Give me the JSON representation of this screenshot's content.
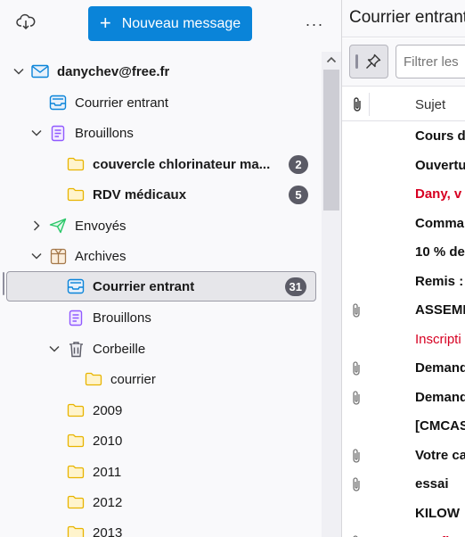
{
  "header": {
    "new_message_label": "Nouveau message",
    "menu_label": "···"
  },
  "folders": {
    "account": {
      "label": "danychev@free.fr"
    },
    "inbox": {
      "label": "Courrier entrant"
    },
    "drafts": {
      "label": "Brouillons"
    },
    "drafts_sub1": {
      "label": "couvercle chlorinateur ma...",
      "badge": "2"
    },
    "drafts_sub2": {
      "label": "RDV médicaux",
      "badge": "5"
    },
    "sent": {
      "label": "Envoyés"
    },
    "archives": {
      "label": "Archives"
    },
    "archives_inbox": {
      "label": "Courrier entrant",
      "badge": "31"
    },
    "archives_drafts": {
      "label": "Brouillons"
    },
    "trash": {
      "label": "Corbeille"
    },
    "trash_sub": {
      "label": "courrier"
    },
    "y2009": {
      "label": "2009"
    },
    "y2010": {
      "label": "2010"
    },
    "y2011": {
      "label": "2011"
    },
    "y2012": {
      "label": "2012"
    },
    "y2013": {
      "label": "2013"
    }
  },
  "message_pane": {
    "title": "Courrier entrant",
    "filter_placeholder": "Filtrer les",
    "columns": {
      "subject": "Sujet"
    },
    "messages": [
      {
        "subject": "Cours d",
        "attach": false,
        "style": "bold"
      },
      {
        "subject": "Ouvertu",
        "attach": false,
        "style": "bold"
      },
      {
        "subject": "Dany, v",
        "attach": false,
        "style": "red-bold"
      },
      {
        "subject": "Comma",
        "attach": false,
        "style": "bold"
      },
      {
        "subject": "10 % de",
        "attach": false,
        "style": "bold"
      },
      {
        "subject": "Remis :",
        "attach": false,
        "style": "bold"
      },
      {
        "subject": "ASSEMI",
        "attach": true,
        "style": "bold"
      },
      {
        "subject": "Inscripti",
        "attach": false,
        "style": "red-normal"
      },
      {
        "subject": "Demand",
        "attach": true,
        "style": "bold"
      },
      {
        "subject": "Demand",
        "attach": true,
        "style": "bold"
      },
      {
        "subject": "[CMCAS",
        "attach": false,
        "style": "bold"
      },
      {
        "subject": "Votre ca",
        "attach": true,
        "style": "bold"
      },
      {
        "subject": "essai",
        "attach": true,
        "style": "bold"
      },
      {
        "subject": "KILOW",
        "attach": false,
        "style": "bold"
      },
      {
        "subject": "Confirm",
        "attach": true,
        "style": "red-bold"
      }
    ]
  },
  "colors": {
    "accent": "#0a84d9",
    "unread_red": "#d70022",
    "badge": "#5b5b66",
    "folder_yellow": "#f5c542",
    "sent_green": "#2ac769",
    "drafts_purple": "#9059ff",
    "inbox_blue": "#0a84d9"
  },
  "icons": {
    "get_messages": "cloud-download-icon",
    "account": "envelope-icon",
    "inbox": "inbox-icon",
    "drafts": "draft-icon",
    "folder": "folder-icon",
    "sent": "paper-plane-icon",
    "archives": "archive-box-icon",
    "trash": "trash-icon",
    "pin": "pin-icon",
    "attachment": "paperclip-icon"
  }
}
